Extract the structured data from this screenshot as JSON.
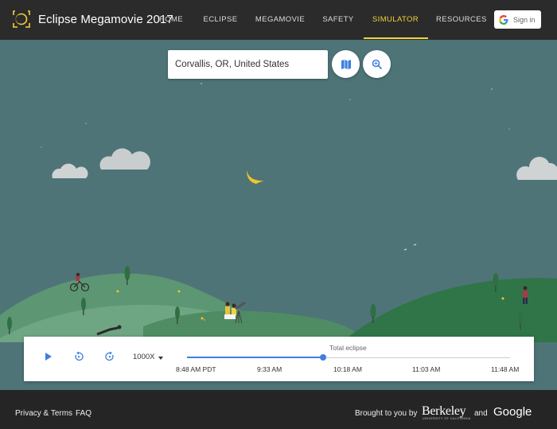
{
  "header": {
    "brand": "Eclipse Megamovie 2017",
    "nav": [
      {
        "label": "HOME"
      },
      {
        "label": "ECLIPSE"
      },
      {
        "label": "MEGAMOVIE"
      },
      {
        "label": "SAFETY"
      },
      {
        "label": "SIMULATOR",
        "active": true
      },
      {
        "label": "RESOURCES"
      }
    ],
    "signin_label": "Sign in",
    "accent_color": "#f2d23c"
  },
  "search": {
    "value": "Corvallis, OR, United States",
    "map_button_icon": "map-icon",
    "zoom_button_icon": "zoom-in-icon"
  },
  "timeline": {
    "speed": "1000X",
    "event_label": "Total eclipse",
    "progress": 0.42,
    "ticks": [
      "8:48 AM PDT",
      "9:33 AM",
      "10:18 AM",
      "11:03 AM",
      "11:48 AM"
    ],
    "accent_color": "#3f7fe0"
  },
  "footer": {
    "privacy": "Privacy & Terms",
    "faq": "FAQ",
    "brought": "Brought to you by",
    "berkeley": "Berkeley",
    "berkeley_sub": "UNIVERSITY OF CALIFORNIA",
    "and": "and",
    "google": "Google"
  }
}
